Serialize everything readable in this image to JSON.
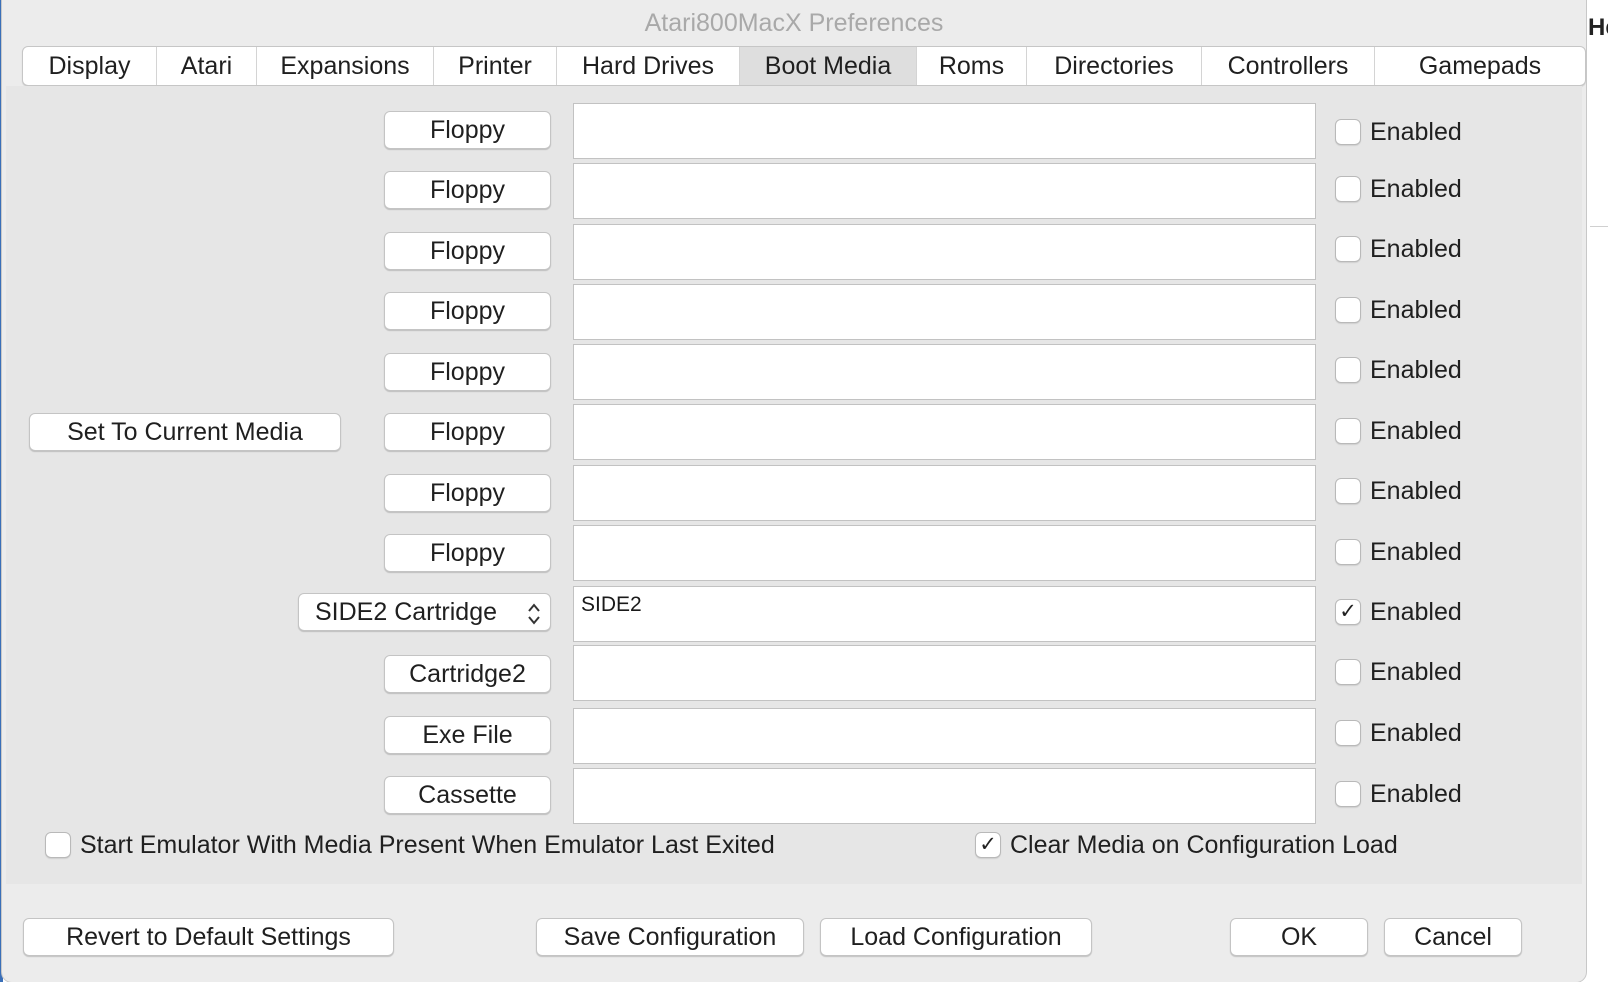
{
  "window": {
    "title": "Atari800MacX Preferences"
  },
  "background": {
    "edge_text": "He"
  },
  "tabs": [
    {
      "label": "Display",
      "active": false
    },
    {
      "label": "Atari",
      "active": false
    },
    {
      "label": "Expansions",
      "active": false
    },
    {
      "label": "Printer",
      "active": false
    },
    {
      "label": "Hard Drives",
      "active": false
    },
    {
      "label": "Boot Media",
      "active": true
    },
    {
      "label": "Roms",
      "active": false
    },
    {
      "label": "Directories",
      "active": false
    },
    {
      "label": "Controllers",
      "active": false
    },
    {
      "label": "Gamepads",
      "active": false
    }
  ],
  "set_current_label": "Set To Current Media",
  "cartridge_type": {
    "selected": "SIDE2 Cartridge"
  },
  "media_rows": [
    {
      "button": "Floppy",
      "path": "",
      "enabled_label": "Enabled",
      "enabled": false
    },
    {
      "button": "Floppy",
      "path": "",
      "enabled_label": "Enabled",
      "enabled": false
    },
    {
      "button": "Floppy",
      "path": "",
      "enabled_label": "Enabled",
      "enabled": false
    },
    {
      "button": "Floppy",
      "path": "",
      "enabled_label": "Enabled",
      "enabled": false
    },
    {
      "button": "Floppy",
      "path": "",
      "enabled_label": "Enabled",
      "enabled": false
    },
    {
      "button": "Floppy",
      "path": "",
      "enabled_label": "Enabled",
      "enabled": false
    },
    {
      "button": "Floppy",
      "path": "",
      "enabled_label": "Enabled",
      "enabled": false
    },
    {
      "button": "Floppy",
      "path": "",
      "enabled_label": "Enabled",
      "enabled": false
    },
    {
      "button": "SIDE2 Cartridge",
      "path": "SIDE2",
      "enabled_label": "Enabled",
      "enabled": true
    },
    {
      "button": "Cartridge2",
      "path": "",
      "enabled_label": "Enabled",
      "enabled": false
    },
    {
      "button": "Exe File",
      "path": "",
      "enabled_label": "Enabled",
      "enabled": false
    },
    {
      "button": "Cassette",
      "path": "",
      "enabled_label": "Enabled",
      "enabled": false
    }
  ],
  "options": {
    "start_with_media": {
      "label": "Start Emulator With Media Present When Emulator Last Exited",
      "checked": false
    },
    "clear_on_load": {
      "label": "Clear Media on Configuration Load",
      "checked": true
    }
  },
  "footer": {
    "revert": "Revert to Default Settings",
    "save": "Save Configuration",
    "load": "Load Configuration",
    "ok": "OK",
    "cancel": "Cancel"
  },
  "glyphs": {
    "check": "✓"
  },
  "colors": {
    "active_tab": "#dedede",
    "panel": "#e6e6e6",
    "window": "#ececec"
  }
}
